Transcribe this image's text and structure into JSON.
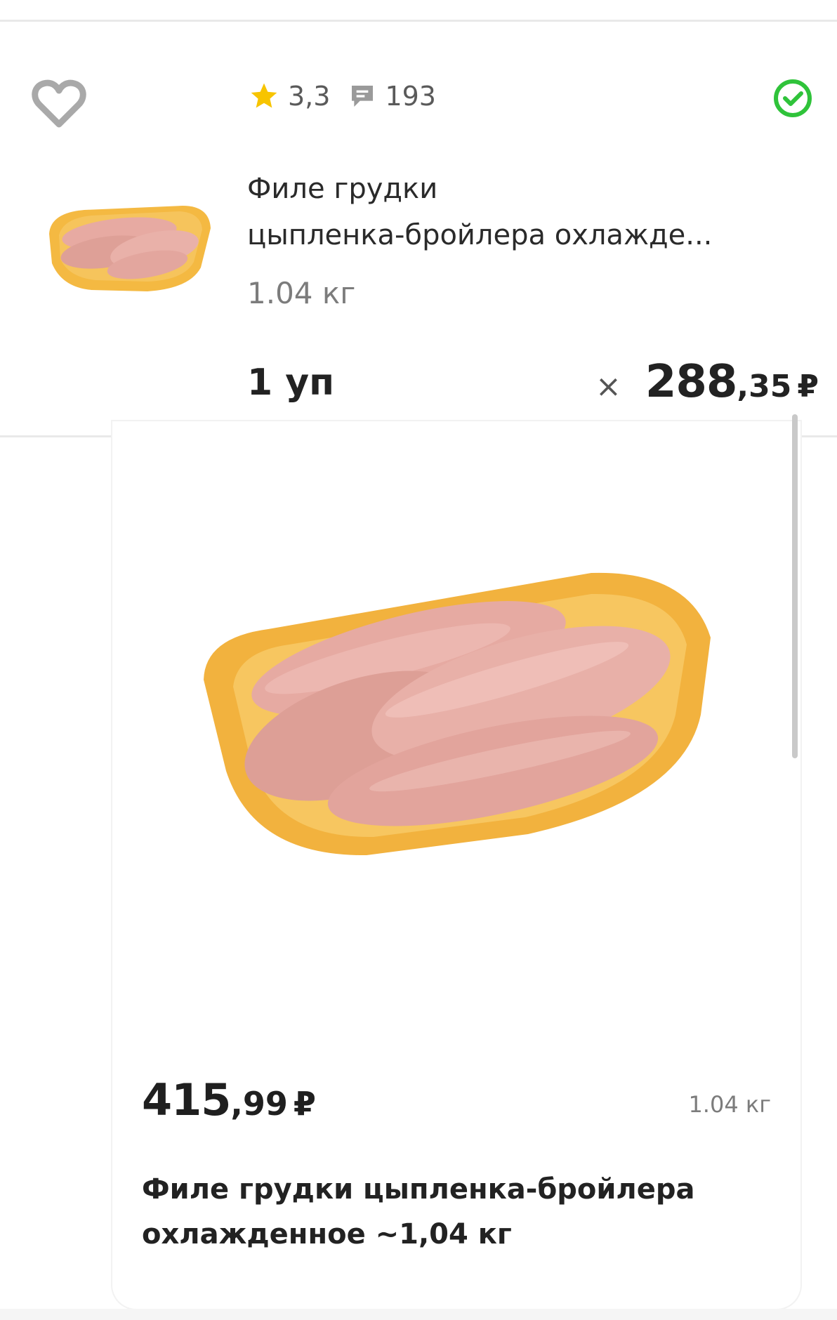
{
  "cart_item": {
    "rating": "3,3",
    "reviews_count": "193",
    "title_line1": "Филе грудки",
    "title_line2": "цыпленка-бройлера охлажде...",
    "weight": "1.04 кг",
    "quantity": "1 уп",
    "times_sign": "×",
    "price_int": "288",
    "price_frac": ",35",
    "currency": "₽"
  },
  "product_card": {
    "price_int": "415",
    "price_frac": ",99",
    "currency": "₽",
    "weight": "1.04 кг",
    "title_line1": "Филе грудки цыпленка-бройлера",
    "title_line2": "охлажденное ~1,04 кг"
  },
  "colors": {
    "star": "#f7c400",
    "available_green": "#2fc33a",
    "heart_gray": "#a9a9a9",
    "tray_yellow": "#f4b942",
    "meat_pink": "#e7aaa2"
  },
  "icons": {
    "favorite": "heart-icon",
    "rating": "star-icon",
    "reviews": "comment-icon",
    "availability": "check-circle-icon"
  }
}
